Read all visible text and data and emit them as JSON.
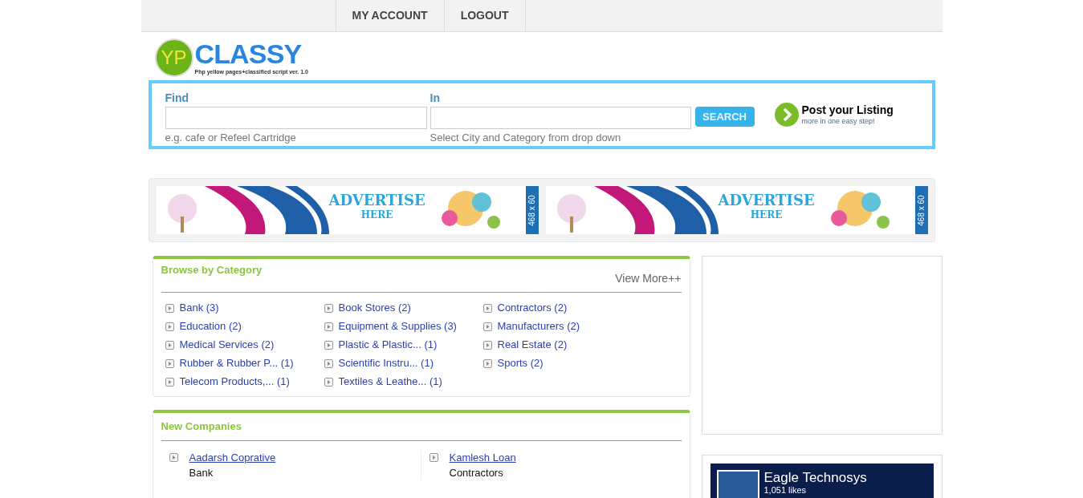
{
  "nav": {
    "items": [
      "MY ACCOUNT",
      "LOGOUT"
    ]
  },
  "logo": {
    "mark": "YP",
    "name": "CLASSY",
    "tagline": "Php yellow pages+classified script ver. 1.0"
  },
  "search": {
    "find_label": "Find",
    "find_hint": "e.g. cafe or Refeel Cartridge",
    "in_label": "In",
    "in_hint": "Select City and Category from drop down",
    "button": "SEARCH"
  },
  "post_listing": {
    "title": "Post your Listing",
    "subtitle": "more in one easy step!"
  },
  "ads": [
    {
      "headline": "ADVERTISE",
      "subline": "HERE",
      "size": "468 x 60"
    },
    {
      "headline": "ADVERTISE",
      "subline": "HERE",
      "size": "468 x 60"
    }
  ],
  "categories": {
    "title": "Browse by Category",
    "view_more": "View More++",
    "items": [
      {
        "name": "Bank",
        "count": "(3)"
      },
      {
        "name": "Book Stores",
        "count": "(2)"
      },
      {
        "name": "Contractors",
        "count": "(2)"
      },
      {
        "name": "Education",
        "count": "(2)"
      },
      {
        "name": "Equipment & Supplies",
        "count": "(3)"
      },
      {
        "name": "Manufacturers",
        "count": "(2)"
      },
      {
        "name": "Medical Services",
        "count": "(2)"
      },
      {
        "name": "Plastic & Plastic...",
        "count": "(1)"
      },
      {
        "name": "Real Estate",
        "count": "(2)"
      },
      {
        "name": "Rubber & Rubber P...",
        "count": "(1)"
      },
      {
        "name": "Scientific Instru...",
        "count": "(1)"
      },
      {
        "name": "Sports",
        "count": "(2)"
      },
      {
        "name": "Telecom Products,...",
        "count": "(1)"
      },
      {
        "name": "Textiles & Leathe...",
        "count": "(1)"
      }
    ]
  },
  "new_companies": {
    "title": "New Companies",
    "items": [
      {
        "name": "Aadarsh Coprative",
        "category": "Bank"
      },
      {
        "name": "Kamlesh Loan",
        "category": "Contractors"
      }
    ]
  },
  "facebook": {
    "page_name": "Eagle Technosys",
    "likes": "1,051 likes"
  }
}
